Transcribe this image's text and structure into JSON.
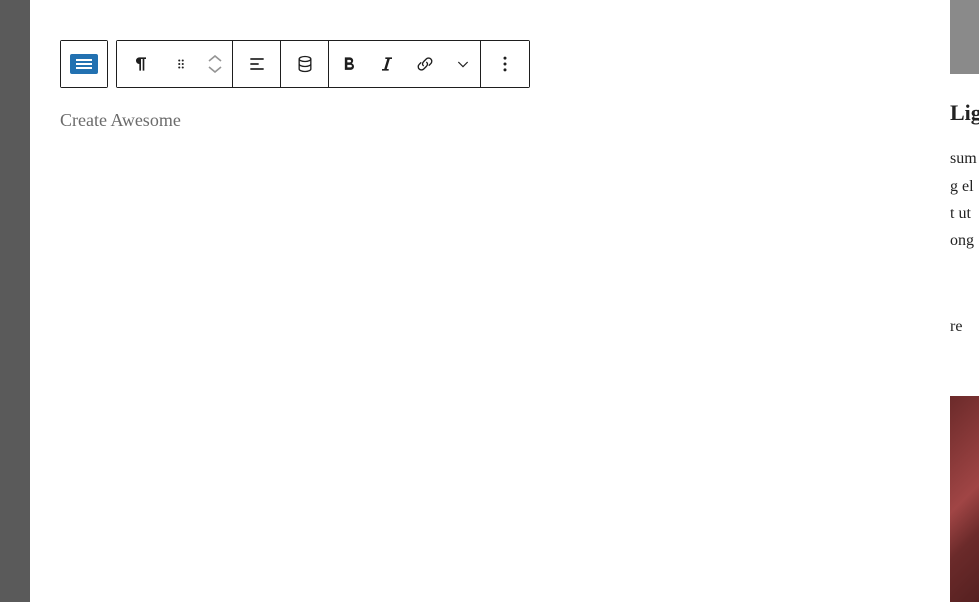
{
  "toolbar": {
    "block_type": "paragraph-block",
    "paragraph": "paragraph",
    "drag": "drag",
    "move_up": "move-up",
    "move_down": "move-down",
    "align": "align-left",
    "data_source": "data-source",
    "bold": "bold",
    "italic": "italic",
    "link": "link",
    "more_rich": "more-rich-text",
    "options": "options"
  },
  "editor": {
    "placeholder": "Create Awesome",
    "content": "Create Awesome"
  },
  "sidebar": {
    "heading": "Lig",
    "line1": "sum",
    "line2": "g el",
    "line3": "t ut",
    "line4": "ong",
    "line5": "re"
  }
}
